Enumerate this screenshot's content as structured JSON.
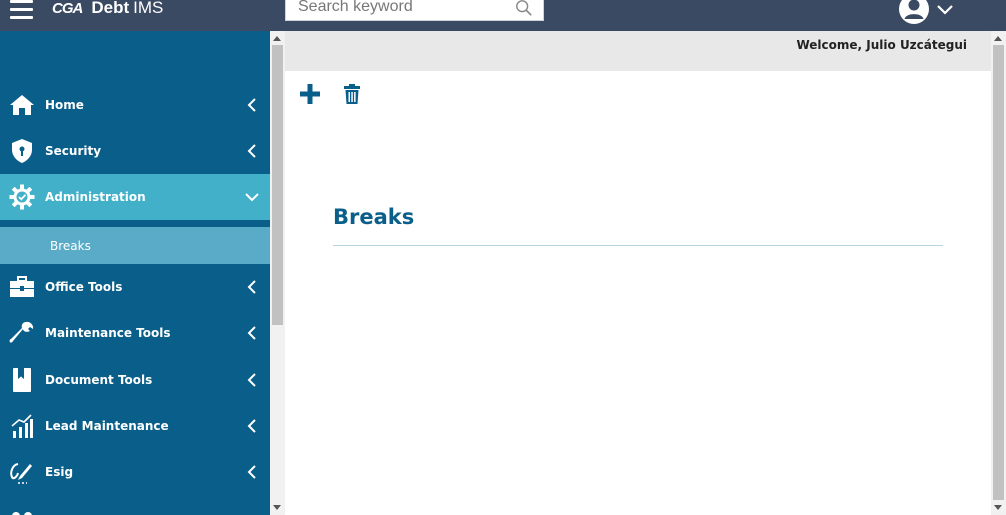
{
  "app": {
    "brand_mark": "CGA",
    "brand_name_bold": "Debt",
    "brand_name_light": "IMS"
  },
  "search": {
    "placeholder": "Search keyword",
    "value": ""
  },
  "header": {
    "welcome": "Welcome, Julio Uzcátegui"
  },
  "sidebar": {
    "items": [
      {
        "label": "Home",
        "icon": "home-icon"
      },
      {
        "label": "Security",
        "icon": "shield-icon"
      },
      {
        "label": "Administration",
        "icon": "gear-check-icon",
        "expanded": true
      },
      {
        "label": "Office Tools",
        "icon": "toolbox-icon"
      },
      {
        "label": "Maintenance Tools",
        "icon": "wrench-icon"
      },
      {
        "label": "Document Tools",
        "icon": "bookmark-icon"
      },
      {
        "label": "Lead Maintenance",
        "icon": "bar-chart-icon"
      },
      {
        "label": "Esig",
        "icon": "signature-icon"
      }
    ],
    "subitem": {
      "label": "Breaks"
    }
  },
  "toolbar": {
    "add_icon": "plus-icon",
    "delete_icon": "trash-icon"
  },
  "main": {
    "title": "Breaks"
  },
  "colors": {
    "topbar": "#3b4a63",
    "sidebar": "#0a5f8a",
    "sidebar_active": "#41b0c8",
    "sidebar_sub": "#5aabc7",
    "accent": "#0a5f8a"
  }
}
